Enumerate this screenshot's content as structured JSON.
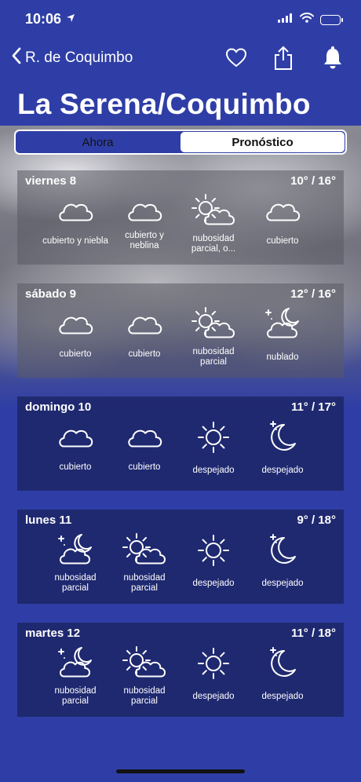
{
  "status": {
    "time": "10:06"
  },
  "nav": {
    "back_label": "R. de Coquimbo"
  },
  "title": "La Serena/Coquimbo",
  "tabs": {
    "now": "Ahora",
    "forecast": "Pronóstico",
    "active": "forecast"
  },
  "days": [
    {
      "day": "viernes 8",
      "temps": "10° / 16°",
      "slots": [
        {
          "icon": "cloud-icon",
          "label": "cubierto y niebla"
        },
        {
          "icon": "cloud-icon",
          "label": "cubierto y neblina"
        },
        {
          "icon": "sun-cloud-icon",
          "label": "nubosidad parcial, o..."
        },
        {
          "icon": "cloud-icon",
          "label": "cubierto"
        }
      ]
    },
    {
      "day": "sábado 9",
      "temps": "12° / 16°",
      "slots": [
        {
          "icon": "cloud-icon",
          "label": "cubierto"
        },
        {
          "icon": "cloud-icon",
          "label": "cubierto"
        },
        {
          "icon": "sun-cloud-icon",
          "label": "nubosidad parcial"
        },
        {
          "icon": "moon-cloud-icon",
          "label": "nublado"
        }
      ]
    },
    {
      "day": "domingo 10",
      "temps": "11° / 17°",
      "slots": [
        {
          "icon": "cloud-icon",
          "label": "cubierto"
        },
        {
          "icon": "cloud-icon",
          "label": "cubierto"
        },
        {
          "icon": "sun-icon",
          "label": "despejado"
        },
        {
          "icon": "moon-icon",
          "label": "despejado"
        }
      ]
    },
    {
      "day": "lunes 11",
      "temps": "9° / 18°",
      "slots": [
        {
          "icon": "moon-cloud-icon",
          "label": "nubosidad parcial"
        },
        {
          "icon": "sun-cloud-icon",
          "label": "nubosidad parcial"
        },
        {
          "icon": "sun-icon",
          "label": "despejado"
        },
        {
          "icon": "moon-icon",
          "label": "despejado"
        }
      ]
    },
    {
      "day": "martes 12",
      "temps": "11° / 18°",
      "slots": [
        {
          "icon": "moon-cloud-icon",
          "label": "nubosidad parcial"
        },
        {
          "icon": "sun-cloud-icon",
          "label": "nubosidad parcial"
        },
        {
          "icon": "sun-icon",
          "label": "despejado"
        },
        {
          "icon": "moon-icon",
          "label": "despejado"
        }
      ]
    }
  ]
}
